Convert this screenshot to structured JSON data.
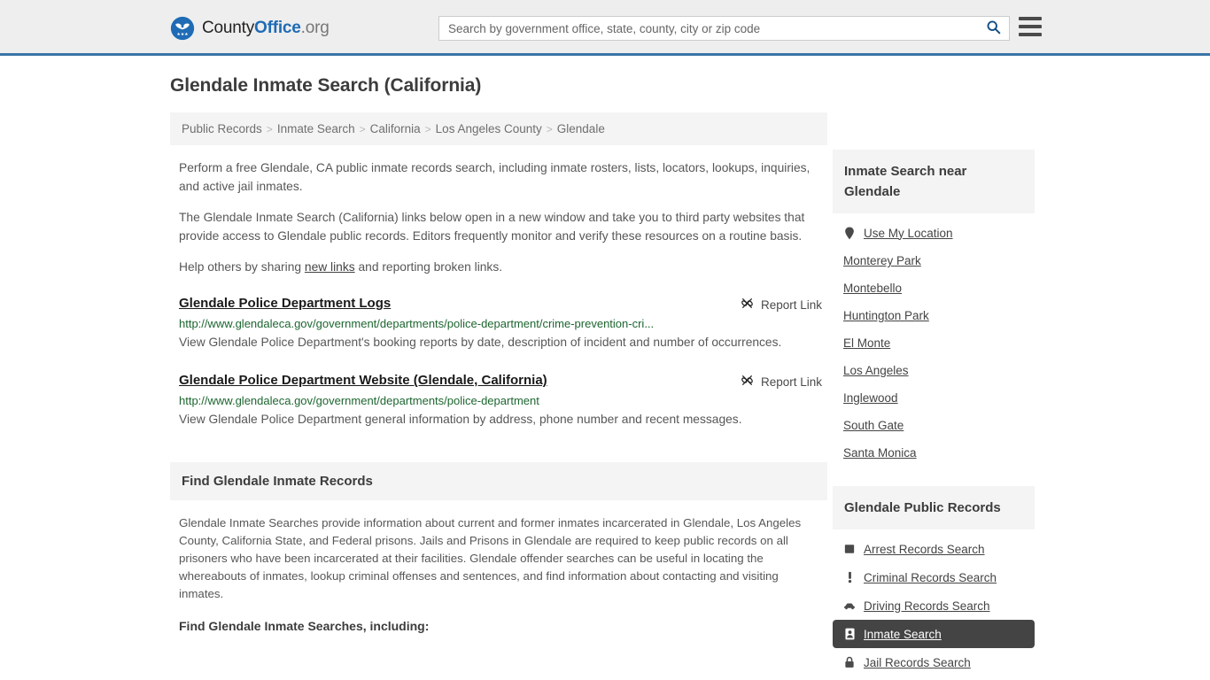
{
  "header": {
    "logo": {
      "part1": "County",
      "part2": "Office",
      "part3": ".org",
      "icon": "eagle-shield-logo-icon"
    },
    "search": {
      "placeholder": "Search by government office, state, county, city or zip code",
      "value": "",
      "icon": "search-icon"
    },
    "menu_icon": "hamburger-menu-icon",
    "accent_color": "#3a74a8"
  },
  "main": {
    "title": "Glendale Inmate Search (California)",
    "breadcrumb": [
      "Public Records",
      "Inmate Search",
      "California",
      "Los Angeles County",
      "Glendale"
    ],
    "breadcrumb_separator": ">",
    "intro": [
      "Perform a free Glendale, CA public inmate records search, including inmate rosters, lists, locators, lookups, inquiries, and active jail inmates.",
      "The Glendale Inmate Search (California) links below open in a new window and take you to third party websites that provide access to Glendale public records. Editors frequently monitor and verify these resources on a routine basis."
    ],
    "share_prefix": "Help others by sharing ",
    "share_link": "new links",
    "share_suffix": " and reporting broken links.",
    "report_label": "Report Link",
    "report_icon": "broken-link-icon",
    "results": [
      {
        "title": "Glendale Police Department Logs",
        "url": "http://www.glendaleca.gov/government/departments/police-department/crime-prevention-cri...",
        "description": "View Glendale Police Department's booking reports by date, description of incident and number of occurrences."
      },
      {
        "title": "Glendale Police Department Website (Glendale, California)",
        "url": "http://www.glendaleca.gov/government/departments/police-department",
        "description": "View Glendale Police Department general information by address, phone number and recent messages."
      }
    ],
    "section": {
      "heading": "Find Glendale Inmate Records",
      "body": "Glendale Inmate Searches provide information about current and former inmates incarcerated in Glendale, Los Angeles County, California State, and Federal prisons. Jails and Prisons in Glendale are required to keep public records on all prisoners who have been incarcerated at their facilities. Glendale offender searches can be useful in locating the whereabouts of inmates, lookup criminal offenses and sentences, and find information about contacting and visiting inmates.",
      "subheading": "Find Glendale Inmate Searches, including:"
    }
  },
  "sidebar": {
    "nearby": {
      "heading": "Inmate Search near Glendale",
      "use_location": {
        "label": "Use My Location",
        "icon": "map-pin-icon"
      },
      "cities": [
        "Monterey Park",
        "Montebello",
        "Huntington Park",
        "El Monte",
        "Los Angeles",
        "Inglewood",
        "South Gate",
        "Santa Monica"
      ]
    },
    "public_records": {
      "heading": "Glendale Public Records",
      "items": [
        {
          "label": "Arrest Records Search",
          "icon": "fingerprint-square-icon",
          "active": false
        },
        {
          "label": "Criminal Records Search",
          "icon": "exclamation-icon",
          "active": false
        },
        {
          "label": "Driving Records Search",
          "icon": "car-icon",
          "active": false
        },
        {
          "label": "Inmate Search",
          "icon": "id-badge-icon",
          "active": true
        },
        {
          "label": "Jail Records Search",
          "icon": "padlock-icon",
          "active": false
        }
      ],
      "active_background": "#444444"
    }
  }
}
